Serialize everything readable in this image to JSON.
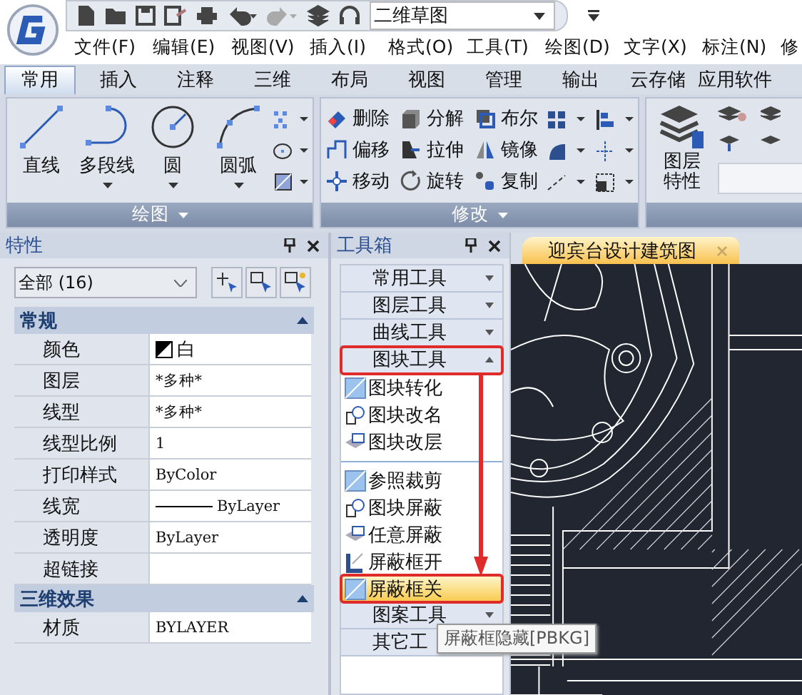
{
  "quick_access": {
    "workspace": "二维草图"
  },
  "menu": [
    "文件(F)",
    "编辑(E)",
    "视图(V)",
    "插入(I)",
    "格式(O)",
    "工具(T)",
    "绘图(D)",
    "文字(X)",
    "标注(N)",
    "修"
  ],
  "ribbon_tabs": [
    {
      "label": "常用",
      "selected": true
    },
    {
      "label": "插入",
      "selected": false
    },
    {
      "label": "注释",
      "selected": false
    },
    {
      "label": "三维",
      "selected": false
    },
    {
      "label": "布局",
      "selected": false
    },
    {
      "label": "视图",
      "selected": false
    },
    {
      "label": "管理",
      "selected": false
    },
    {
      "label": "输出",
      "selected": false
    },
    {
      "label": "云存储",
      "selected": false
    },
    {
      "label": "应用软件",
      "selected": false
    }
  ],
  "ribbon": {
    "draw": {
      "title": "绘图",
      "tools": [
        {
          "label": "直线",
          "has_menu": false
        },
        {
          "label": "多段线",
          "has_menu": true
        },
        {
          "label": "圆",
          "has_menu": true
        },
        {
          "label": "圆弧",
          "has_menu": true
        }
      ]
    },
    "modify": {
      "title": "修改",
      "tools": [
        "删除",
        "分解",
        "布尔",
        "偏移",
        "拉伸",
        "镜像",
        "移动",
        "旋转",
        "复制"
      ]
    },
    "layer": {
      "tool": "图层特性"
    }
  },
  "properties": {
    "title": "特性",
    "selection": "全部 (16)",
    "sections": [
      {
        "title": "常规",
        "expanded": true,
        "rows": [
          {
            "label": "颜色",
            "value": "白",
            "kind": "color"
          },
          {
            "label": "图层",
            "value": "*多种*",
            "kind": "text"
          },
          {
            "label": "线型",
            "value": "*多种*",
            "kind": "text"
          },
          {
            "label": "线型比例",
            "value": "1",
            "kind": "text"
          },
          {
            "label": "打印样式",
            "value": "ByColor",
            "kind": "text"
          },
          {
            "label": "线宽",
            "value": "ByLayer",
            "kind": "lineweight"
          },
          {
            "label": "透明度",
            "value": "ByLayer",
            "kind": "text"
          },
          {
            "label": "超链接",
            "kind": "text"
          }
        ]
      },
      {
        "title": "三维效果",
        "expanded": true,
        "rows": [
          {
            "label": "材质",
            "value": "BYLAYER",
            "kind": "text"
          }
        ]
      }
    ]
  },
  "toolbox": {
    "title": "工具箱",
    "items": [
      {
        "kind": "category",
        "label": "常用工具",
        "expanded": false,
        "annotated": false
      },
      {
        "kind": "category",
        "label": "图层工具",
        "expanded": false,
        "annotated": false
      },
      {
        "kind": "category",
        "label": "曲线工具",
        "expanded": false,
        "annotated": false
      },
      {
        "kind": "category",
        "label": "图块工具",
        "expanded": true,
        "annotated": true
      },
      {
        "kind": "tool",
        "label": "图块转化",
        "selected": false,
        "annotated": false
      },
      {
        "kind": "tool",
        "label": "图块改名",
        "selected": false,
        "annotated": false
      },
      {
        "kind": "tool",
        "label": "图块改层",
        "selected": false,
        "annotated": false
      },
      {
        "kind": "separator"
      },
      {
        "kind": "tool",
        "label": "参照裁剪",
        "selected": false,
        "annotated": false
      },
      {
        "kind": "tool",
        "label": "图块屏蔽",
        "selected": false,
        "annotated": false
      },
      {
        "kind": "tool",
        "label": "任意屏蔽",
        "selected": false,
        "annotated": false
      },
      {
        "kind": "tool",
        "label": "屏蔽框开",
        "selected": false,
        "annotated": false
      },
      {
        "kind": "tool",
        "label": "屏蔽框关",
        "selected": true,
        "annotated": true
      },
      {
        "kind": "category",
        "label": "图案工具",
        "expanded": false,
        "annotated": false
      },
      {
        "kind": "category",
        "label": "其它工",
        "annotated": false
      }
    ]
  },
  "tooltip": {
    "text": "屏蔽框隐藏[PBKG]"
  },
  "document_tab": {
    "title": "迎宾台设计建筑图",
    "selected": true
  }
}
